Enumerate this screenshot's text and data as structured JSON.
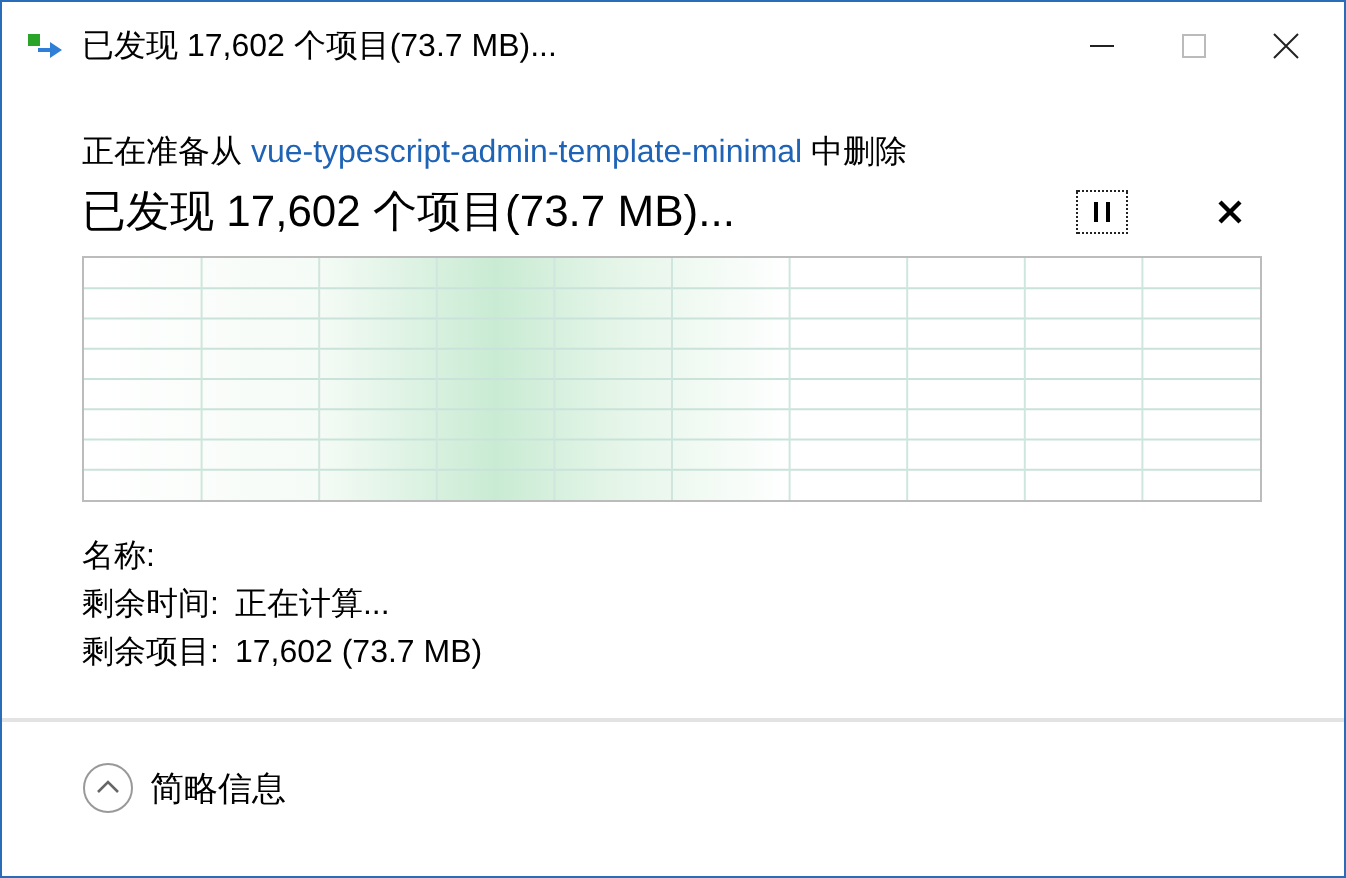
{
  "window": {
    "title": "已发现 17,602 个项目(73.7 MB)..."
  },
  "operation": {
    "prefix": "正在准备从",
    "source": "vue-typescript-admin-template-minimal",
    "suffix": "中删除"
  },
  "progress": {
    "headline": "已发现 17,602 个项目(73.7 MB)...",
    "paused": false
  },
  "details": [
    {
      "label": "名称:"
    },
    {
      "label": "剩余时间:",
      "value": "正在计算..."
    },
    {
      "label": "剩余项目:",
      "value": "17,602 (73.7 MB)"
    }
  ],
  "footer": {
    "toggle": "简略信息",
    "expanded": true
  }
}
